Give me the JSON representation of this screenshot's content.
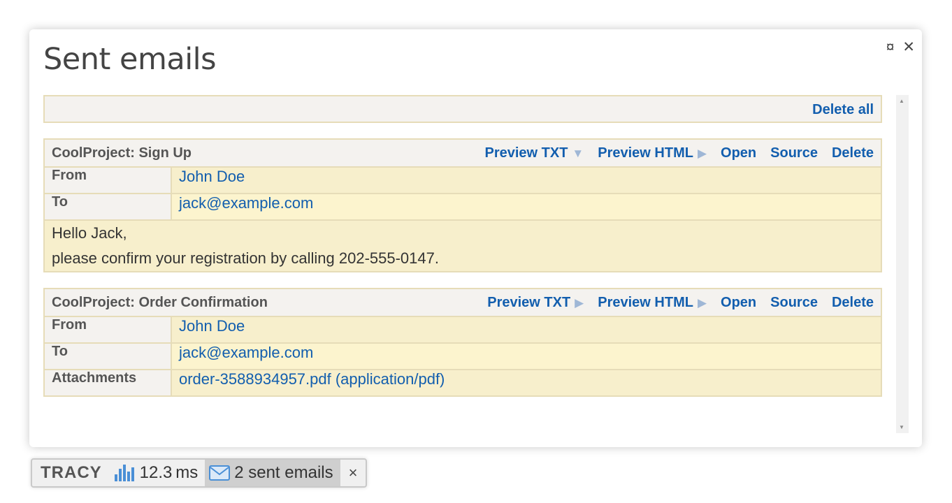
{
  "panel": {
    "title": "Sent emails",
    "icons": [
      "pin-icon",
      "close-icon"
    ],
    "icon_glyphs": {
      "pin": "¤",
      "close": "✕"
    }
  },
  "toolbar": {
    "delete_all_label": "Delete all"
  },
  "emails": [
    {
      "subject": "CoolProject: Sign Up",
      "actions": {
        "preview_txt": "Preview TXT",
        "preview_txt_state": "expanded",
        "preview_html": "Preview HTML",
        "preview_html_state": "collapsed",
        "open": "Open",
        "source": "Source",
        "delete": "Delete"
      },
      "fields": [
        {
          "label": "From",
          "value": "John Doe"
        },
        {
          "label": "To",
          "value": "jack@example.com"
        }
      ],
      "body_lines": [
        "Hello Jack,",
        "please confirm your registration by calling 202-555-0147."
      ]
    },
    {
      "subject": "CoolProject: Order Confirmation",
      "actions": {
        "preview_txt": "Preview TXT",
        "preview_txt_state": "collapsed",
        "preview_html": "Preview HTML",
        "preview_html_state": "collapsed",
        "open": "Open",
        "source": "Source",
        "delete": "Delete"
      },
      "fields": [
        {
          "label": "From",
          "value": "John Doe"
        },
        {
          "label": "To",
          "value": "jack@example.com"
        },
        {
          "label": "Attachments",
          "value": "order-3588934957.pdf (application/pdf)"
        }
      ]
    }
  ],
  "tracy_bar": {
    "logo": "TRACY",
    "time_value": "12.3",
    "time_unit": "ms",
    "emails_label": "2 sent emails",
    "close_glyph": "×"
  },
  "colors": {
    "link": "#125eae",
    "border": "#e6dcb8",
    "header_bg": "#f4f2ef",
    "row_bg": "#f7efcc"
  }
}
